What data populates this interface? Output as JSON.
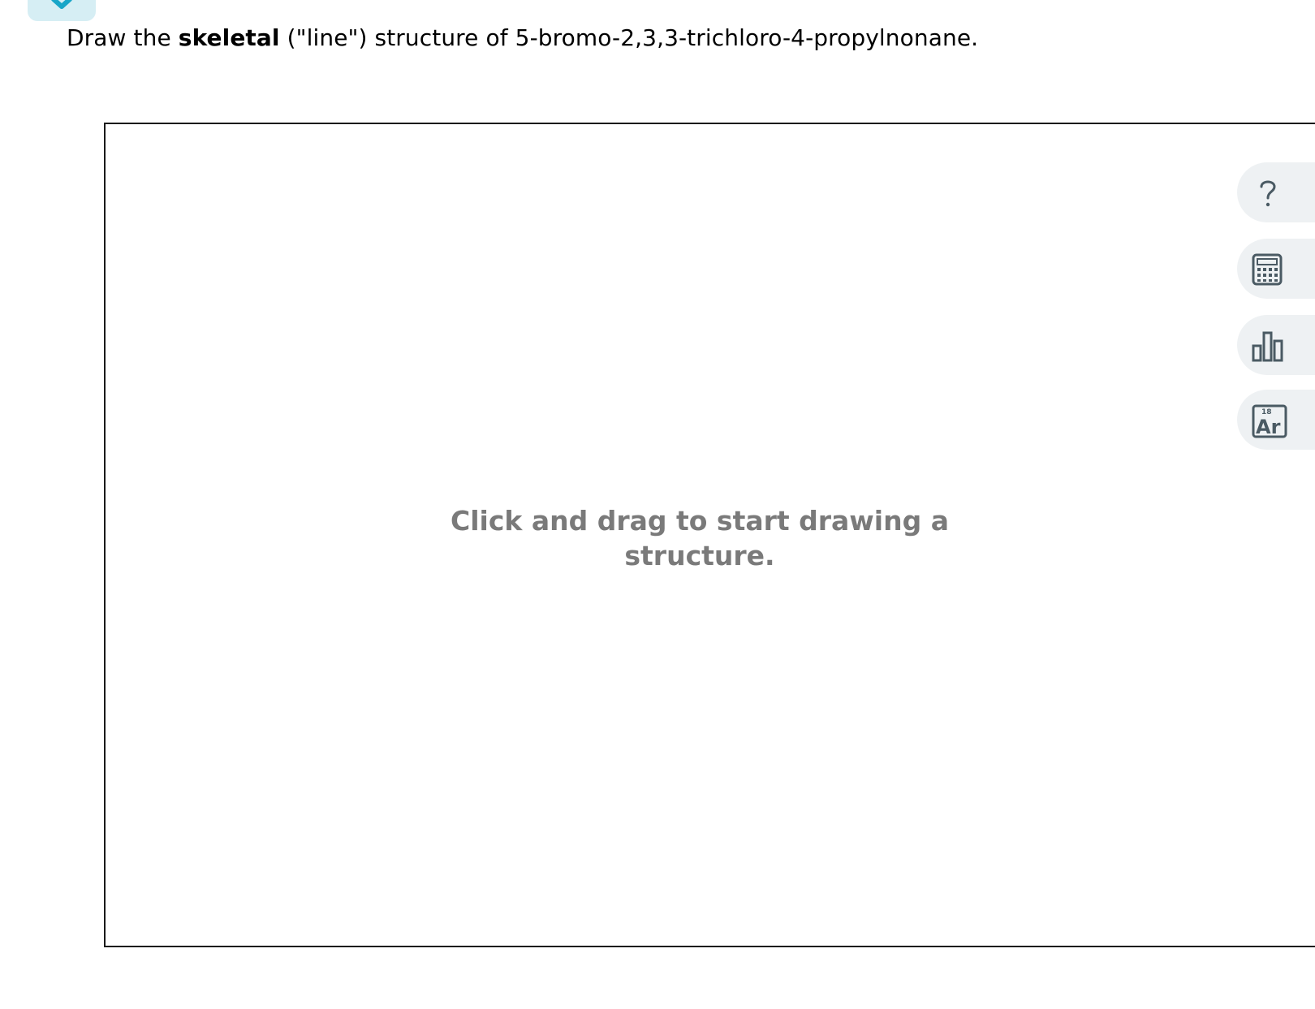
{
  "question": {
    "prefix": "Draw the ",
    "bold": "skeletal",
    "suffix": " (\"line\") structure of 5-bromo-2,3,3-trichloro-4-propylnonane."
  },
  "canvas": {
    "hint_line1": "Click and drag to start drawing a",
    "hint_line2": "structure."
  },
  "toolbar": {
    "tools": [
      {
        "icon": "help-icon"
      },
      {
        "icon": "calculator-icon"
      },
      {
        "icon": "bar-chart-icon"
      },
      {
        "icon": "periodic-table-icon",
        "number": "18",
        "symbol": "Ar"
      }
    ]
  },
  "colors": {
    "accent": "#19a6c8",
    "tab_bg": "#d6eef4",
    "hint_text": "#7a7a7a",
    "tool_bg": "#eef1f3",
    "icon": "#4a5a63"
  }
}
